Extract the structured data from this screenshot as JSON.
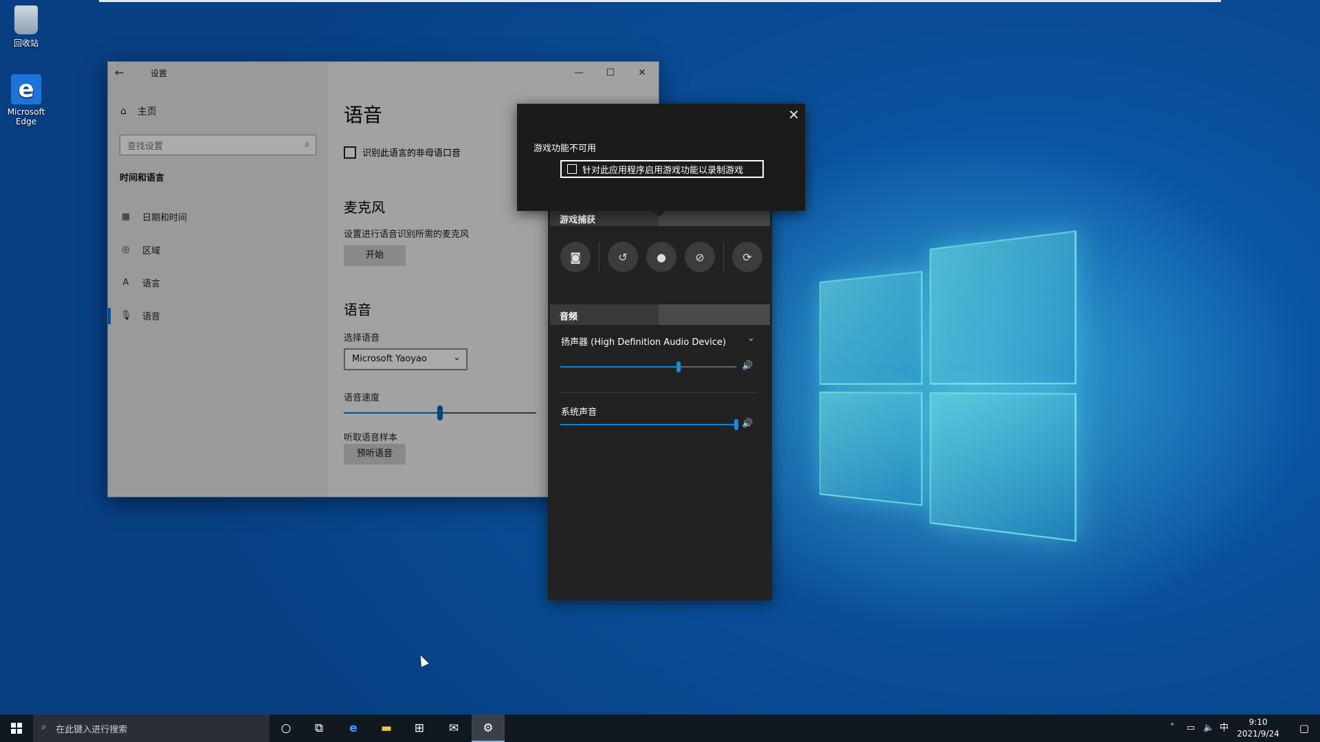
{
  "desktop": {
    "recycle_label": "回收站",
    "edge_label": "Microsoft Edge"
  },
  "settings": {
    "title": "设置",
    "home": "主页",
    "search_placeholder": "查找设置",
    "section": "时间和语言",
    "nav": [
      {
        "label": "日期和时间",
        "icon": "calendar-clock-icon"
      },
      {
        "label": "区域",
        "icon": "globe-icon"
      },
      {
        "label": "语言",
        "icon": "language-icon"
      },
      {
        "label": "语音",
        "icon": "microphone-icon"
      }
    ],
    "content": {
      "page_title": "语音",
      "non_native_checkbox": "识别此语言的非母语口音",
      "mic_heading": "麦克风",
      "mic_desc": "设置进行语音识别所需的麦克风",
      "start_button": "开始",
      "voice_heading": "语音",
      "choose_voice_label": "选择语音",
      "voice_value": "Microsoft Yaoyao",
      "speed_label": "语音速度",
      "speed_value": 0.5,
      "sample_label": "听取语音样本",
      "preview_button": "预听语音"
    }
  },
  "gamebar": {
    "capture_heading": "游戏捕获",
    "capture_buttons": [
      "camera-icon",
      "replay-icon",
      "record-icon",
      "mic-off-icon",
      "broadcast-icon"
    ],
    "audio_heading": "音频",
    "device_label": "扬声器 (High Definition Audio Device)",
    "device_volume": 0.67,
    "system_label": "系统声音",
    "system_volume": 1.0
  },
  "popup": {
    "title": "游戏功能不可用",
    "checkbox_label": "针对此应用程序启用游戏功能以录制游戏"
  },
  "taskbar": {
    "search_placeholder": "在此键入进行搜索",
    "ime": "中",
    "time": "9:10",
    "date": "2021/9/24"
  },
  "colors": {
    "accent": "#0078d7",
    "gamebar_bg": "#222222"
  }
}
